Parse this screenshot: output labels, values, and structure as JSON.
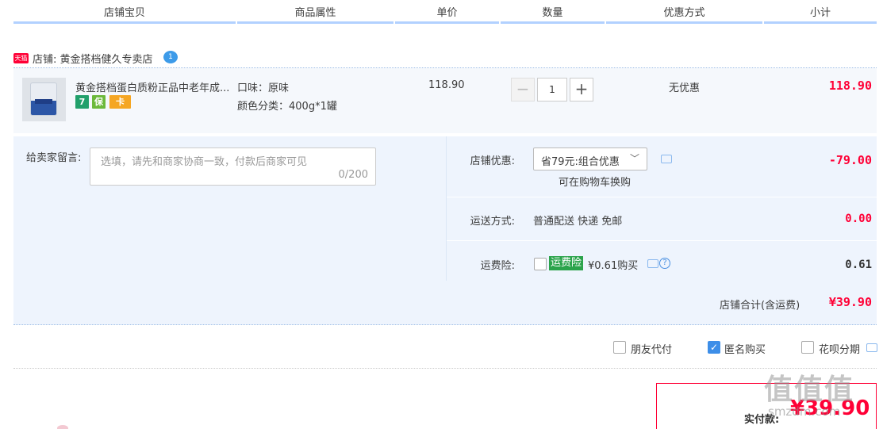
{
  "header": {
    "col_item": "店铺宝贝",
    "col_attr": "商品属性",
    "col_price": "单价",
    "col_qty": "数量",
    "col_discount": "优惠方式",
    "col_subtotal": "小计"
  },
  "shop": {
    "badge": "天猫",
    "label": "店铺: 黄金搭档健久专卖店",
    "chat_icon": "chat-bubble-icon"
  },
  "item": {
    "title": "黄金搭档蛋白质粉正品中老年成...",
    "badges": [
      "7",
      "保",
      "卡"
    ],
    "attr_flavor": "口味：原味",
    "attr_color": "颜色分类：400g*1罐",
    "price": "118.90",
    "qty": "1",
    "minus": "−",
    "plus": "+",
    "discount": "无优惠",
    "subtotal": "118.90"
  },
  "memo": {
    "label": "给卖家留言:",
    "placeholder": "选填，请先和商家协商一致，付款后商家可见",
    "count": "0/200"
  },
  "options": {
    "coupon_label": "店铺优惠:",
    "coupon_value": "省79元:组合优惠",
    "coupon_note": "可在购物车换购",
    "coupon_amount": "-79.00",
    "shipping_label": "运送方式:",
    "shipping_value": "普通配送 快递 免邮",
    "shipping_amount": "0.00",
    "insurance_label": "运费险:",
    "insurance_badge": "运费险",
    "insurance_value": "¥0.61购买",
    "insurance_amount": "0.61",
    "total_label": "店铺合计(含运费)",
    "total_amount": "¥39.90"
  },
  "extras": {
    "friend_pay": "朋友代付",
    "anonymous": "匿名购买",
    "anonymous_checked": true,
    "huabei": "花呗分期"
  },
  "pay": {
    "label": "实付款:",
    "amount": "¥39.90"
  },
  "watermark": {
    "main": "值值值",
    "sub": "smzdm.com"
  },
  "colors": {
    "accent": "#ff0036",
    "header_line": "#b2d1ff",
    "option_bg": "#eef4fd",
    "insurance_green": "#2ba34b"
  }
}
